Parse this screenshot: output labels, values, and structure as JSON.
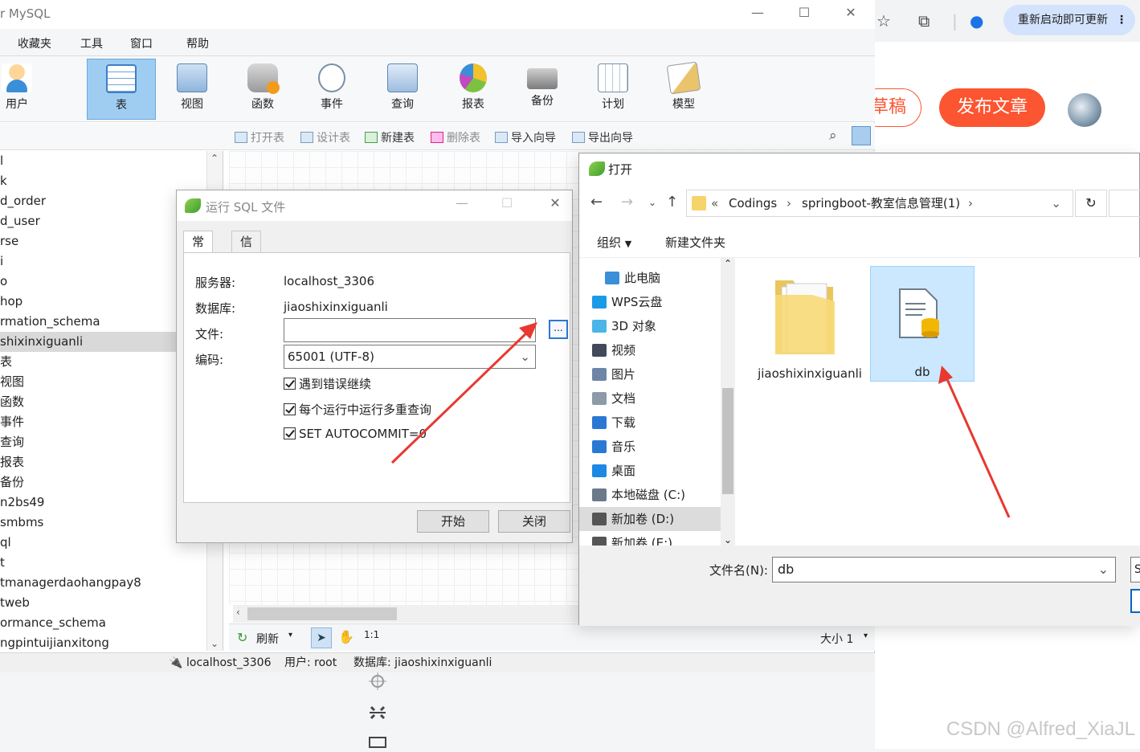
{
  "navicat": {
    "title": "r MySQL",
    "menu": [
      "收藏夹",
      "工具",
      "窗口",
      "帮助"
    ],
    "toolbar": [
      "用户",
      "表",
      "视图",
      "函数",
      "事件",
      "查询",
      "报表",
      "备份",
      "计划",
      "模型"
    ],
    "subbar": [
      "打开表",
      "设计表",
      "新建表",
      "删除表",
      "导入向导",
      "导出向导"
    ],
    "tree": [
      "l",
      "k",
      "d_order",
      "d_user",
      "rse",
      "i",
      "o",
      "hop",
      "rmation_schema",
      "shixinxiguanli",
      "表",
      "视图",
      "函数",
      "事件",
      "查询",
      "报表",
      "备份",
      "n2bs49",
      "smbms",
      "ql",
      "t",
      "tmanagerdaohangpay8",
      "tweb",
      "ormance_schema",
      "ngpintuijianxitong"
    ],
    "bottombar": {
      "refresh": "刷新",
      "size": "大小 1"
    },
    "status": {
      "server": "localhost_3306",
      "user": "用户: root",
      "database": "数据库: jiaoshixinxiguanli"
    }
  },
  "sql_dialog": {
    "title": "运行 SQL 文件",
    "tabs": [
      "常规",
      "信息日志"
    ],
    "server_label": "服务器:",
    "server_value": "localhost_3306",
    "database_label": "数据库:",
    "database_value": "jiaoshixinxiguanli",
    "file_label": "文件:",
    "file_value": "",
    "browse": "...",
    "encoding_label": "编码:",
    "encoding_value": "65001 (UTF-8)",
    "options": [
      "遇到错误继续",
      "每个运行中运行多重查询",
      "SET AUTOCOMMIT=0"
    ],
    "start": "开始",
    "close": "关闭"
  },
  "open_dialog": {
    "title": "打开",
    "breadcrumb": {
      "prefix": "«",
      "parts": [
        "Codings",
        "springboot-教室信息管理(1)"
      ]
    },
    "organize": "组织",
    "new_folder": "新建文件夹",
    "nav": [
      "此电脑",
      "WPS云盘",
      "3D 对象",
      "视频",
      "图片",
      "文档",
      "下载",
      "音乐",
      "桌面",
      "本地磁盘 (C:)",
      "新加卷 (D:)",
      "新加卷 (E:)"
    ],
    "files": [
      "jiaoshixinxiguanli",
      "db"
    ],
    "filename_label": "文件名(N):",
    "filename_value": "db",
    "side_button": "S"
  },
  "browser": {
    "update_label": "重新启动即可更新",
    "draft": "草稿",
    "publish": "发布文章",
    "watermark": "CSDN @Alfred_XiaJL"
  },
  "colors": {
    "accent": "#2b78d4",
    "arrow": "#e8382f",
    "publish": "#fc5531"
  }
}
